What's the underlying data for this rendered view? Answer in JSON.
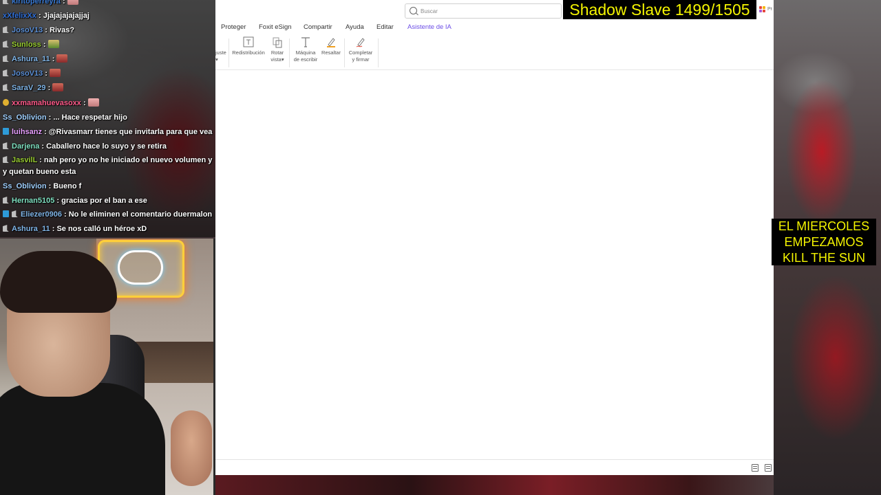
{
  "overlay": {
    "title": "Shadow Slave 1499/1505",
    "side_lines": [
      "EL MIERCOLES",
      "EMPEZAMOS",
      "KILL THE SUN"
    ]
  },
  "app": {
    "search": {
      "placeholder": "Buscar"
    },
    "apps_label": "Pr",
    "menu": [
      "Proteger",
      "Foxit eSign",
      "Compartir",
      "Ayuda",
      "Editar",
      "Asistente de IA"
    ],
    "menu_active": "Asistente de IA",
    "ribbon": {
      "partial_left": [
        "juste",
        "▾"
      ],
      "redistribucion": "Redistribución",
      "rotar": [
        "Rotar",
        "vista▾"
      ],
      "maquina": [
        "Máquina",
        "de escribir"
      ],
      "resaltar": "Resaltar",
      "completar": [
        "Completar",
        "y firmar"
      ]
    },
    "accent_color": "#6b4de6"
  },
  "chat": {
    "messages": [
      {
        "user": "kiritoperreyra",
        "color": "#3a7bd5",
        "badges": [
          "gray"
        ],
        "text": "",
        "emote": "pink"
      },
      {
        "user": "xXfelixXx",
        "color": "#2f6fd8",
        "badges": [],
        "text": "Jjajajajajajjaj"
      },
      {
        "user": "JosoV13",
        "color": "#5b8fd6",
        "badges": [
          "gray"
        ],
        "text": "Rivas?"
      },
      {
        "user": "Sunloss",
        "color": "#9acd32",
        "badges": [
          "gray"
        ],
        "text": "",
        "emote": "grn"
      },
      {
        "user": "Ashura_11",
        "color": "#7fb4e6",
        "badges": [
          "gray"
        ],
        "text": "",
        "emote": "red"
      },
      {
        "user": "JosoV13",
        "color": "#5b8fd6",
        "badges": [
          "gray"
        ],
        "text": "",
        "emote": "red"
      },
      {
        "user": "SaraV_29",
        "color": "#7fb4e6",
        "badges": [
          "gray"
        ],
        "text": "",
        "emote": "red"
      },
      {
        "user": "xxmamahuevasoxx",
        "color": "#ff5a8a",
        "badges": [
          "gold"
        ],
        "text": "",
        "emote": "pink"
      },
      {
        "user": "Ss_Oblivion",
        "color": "#a0d0ff",
        "badges": [],
        "text": "... Hace respetar hijo"
      },
      {
        "user": "luihsanz",
        "color": "#e8a0ff",
        "badges": [
          "blue"
        ],
        "text": "@Rivasmarr tienes que invitarla para que vea c"
      },
      {
        "user": "Darjena",
        "color": "#7fe0c0",
        "badges": [
          "gray"
        ],
        "text": "Caballero hace lo suyo y se retira"
      },
      {
        "user": "JasvilL",
        "color": "#9acd32",
        "badges": [
          "gray"
        ],
        "text": "nah pero yo no he iniciado el nuevo volumen y y quetan bueno esta"
      },
      {
        "user": "Ss_Oblivion",
        "color": "#a0d0ff",
        "badges": [],
        "text": "Bueno f"
      },
      {
        "user": "Hernan5105",
        "color": "#7fe0c0",
        "badges": [
          "gray"
        ],
        "text": "gracias por el ban a ese"
      },
      {
        "user": "Eliezer0906",
        "color": "#7fb4e6",
        "badges": [
          "blue",
          "gray"
        ],
        "text": "No le eliminen el comentario duermalon"
      },
      {
        "user": "Ashura_11",
        "color": "#7fb4e6",
        "badges": [
          "gray"
        ],
        "text": "Se nos calló un héroe xD"
      }
    ]
  }
}
